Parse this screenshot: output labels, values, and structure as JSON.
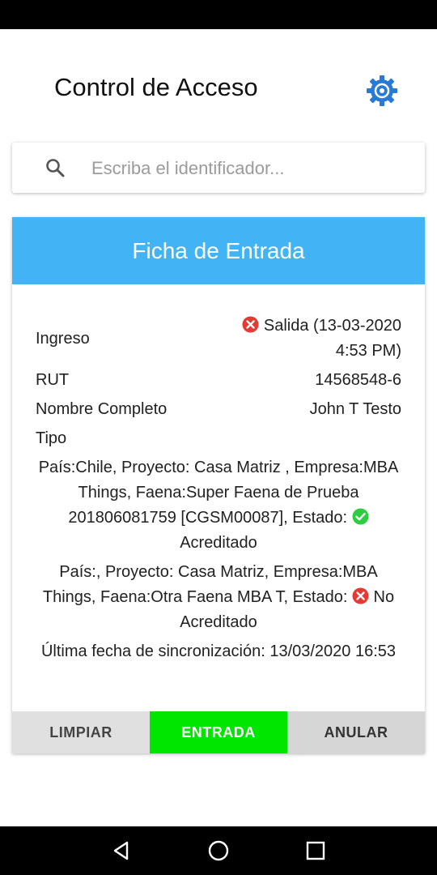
{
  "header": {
    "title": "Control de Acceso",
    "settings_icon": "gear-icon"
  },
  "search": {
    "placeholder": "Escriba el identificador..."
  },
  "card": {
    "title": "Ficha de Entrada",
    "ingreso": {
      "label": "Ingreso",
      "value": "Salida (13-03-2020 4:53 PM)",
      "status_icon": "error-icon"
    },
    "rut": {
      "label": "RUT",
      "value": "14568548-6"
    },
    "nombre": {
      "label": "Nombre Completo",
      "value": "John T Testo"
    },
    "tipo": {
      "label": "Tipo"
    },
    "entries": [
      {
        "text": "País:Chile, Proyecto: Casa Matriz , Empresa:MBA Things, Faena:Super Faena de Prueba 201806081759 [CGSM00087], Estado:",
        "status": "Acreditado",
        "status_icon": "check-circle-icon",
        "status_color": "#2ecc40"
      },
      {
        "text": "País:, Proyecto: Casa Matriz, Empresa:MBA Things, Faena:Otra Faena MBA T, Estado:",
        "status": "No Acreditado",
        "status_icon": "error-icon",
        "status_color": "#e53935"
      }
    ],
    "sync": "Última fecha de sincronización: 13/03/2020 16:53"
  },
  "actions": {
    "clear": "LIMPIAR",
    "entry": "ENTRADA",
    "cancel": "ANULAR"
  },
  "colors": {
    "header": "#42b4f5",
    "entry_button": "#00e600",
    "gear": "#2979d6"
  }
}
